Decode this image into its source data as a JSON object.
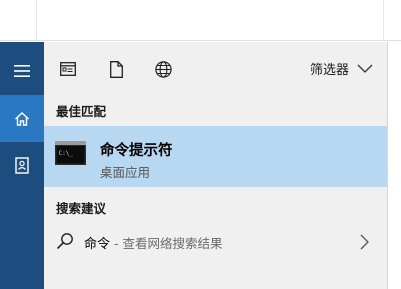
{
  "rail": {
    "items": [
      {
        "icon": "hamburger-menu-icon"
      },
      {
        "icon": "home-icon",
        "active": true
      },
      {
        "icon": "contact-card-icon"
      }
    ]
  },
  "toolbar": {
    "tools": [
      {
        "icon": "apps-window-icon"
      },
      {
        "icon": "document-icon"
      },
      {
        "icon": "globe-icon"
      }
    ],
    "filter_label": "筛选器"
  },
  "best_match": {
    "heading": "最佳匹配",
    "title": "命令提示符",
    "subtitle": "桌面应用",
    "icon": "command-prompt-icon"
  },
  "suggestions": {
    "heading": "搜索建议",
    "items": [
      {
        "query": "命令",
        "hint": " - 查看网络搜索结果"
      }
    ]
  },
  "colors": {
    "rail_bg": "#1d4d7e",
    "rail_active": "#2a78c2",
    "panel_bg": "#f0f0f0",
    "selection": "#b8d7f0"
  }
}
